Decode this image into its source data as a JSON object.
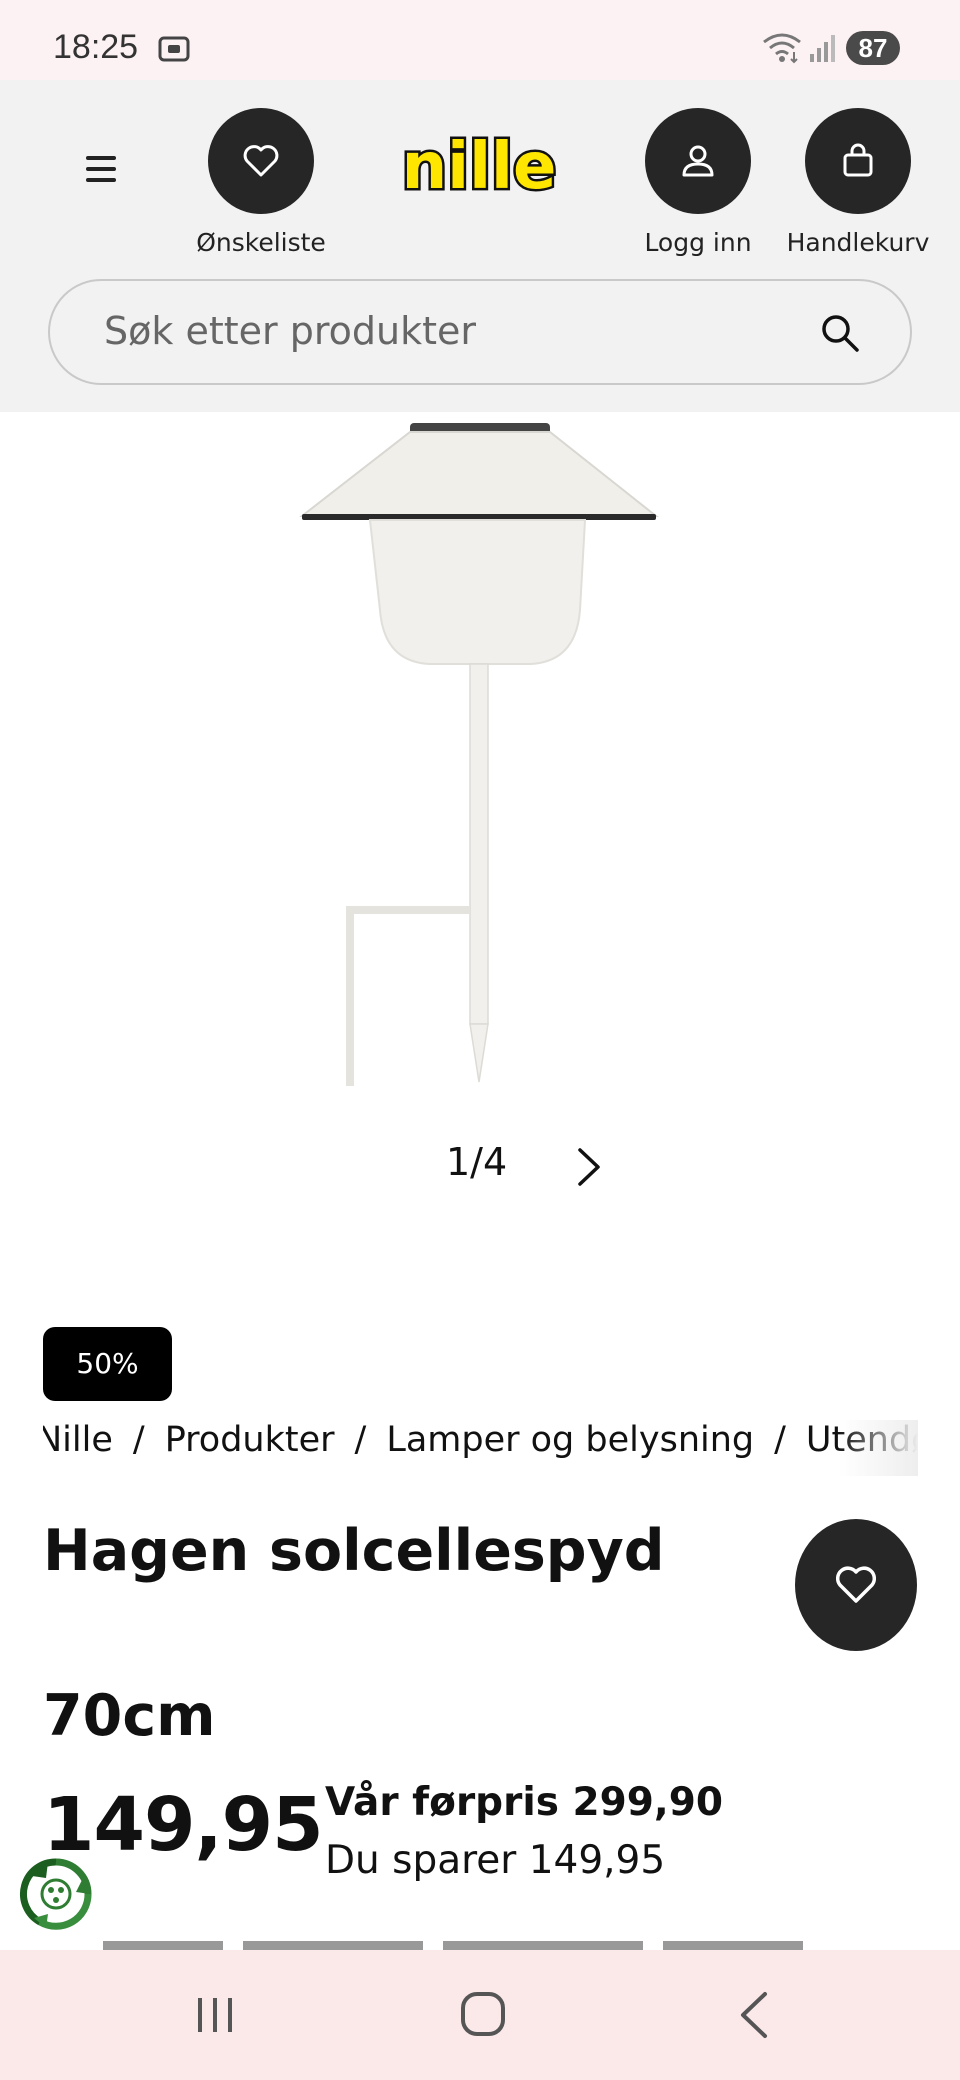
{
  "status_bar": {
    "time": "18:25",
    "battery": "87",
    "icons": [
      "screenshot-icon",
      "wifi-icon",
      "signal-icon"
    ]
  },
  "header": {
    "logo_text": "nille",
    "wishlist_label": "Ønskeliste",
    "login_label": "Logg inn",
    "cart_label": "Handlekurv",
    "search_placeholder": "Søk etter produkter"
  },
  "gallery": {
    "pager": "1/4"
  },
  "product": {
    "discount_badge": "50%",
    "breadcrumb": [
      "Nille",
      "Produkter",
      "Lamper og belysning",
      "Utendørs"
    ],
    "breadcrumb_sep": "/",
    "title": "Hagen solcellespyd",
    "size": "70cm",
    "price": "149,95",
    "previous_price": "Vår førpris 299,90",
    "savings": "Du sparer 149,95"
  },
  "colors": {
    "header_bg": "#f2f2f2",
    "button_dark": "#262626",
    "logo_yellow": "#ffe600",
    "status_bg": "#fdf2f3",
    "nav_bg": "#fbe9ea",
    "eco_green": "#2e7d32"
  }
}
